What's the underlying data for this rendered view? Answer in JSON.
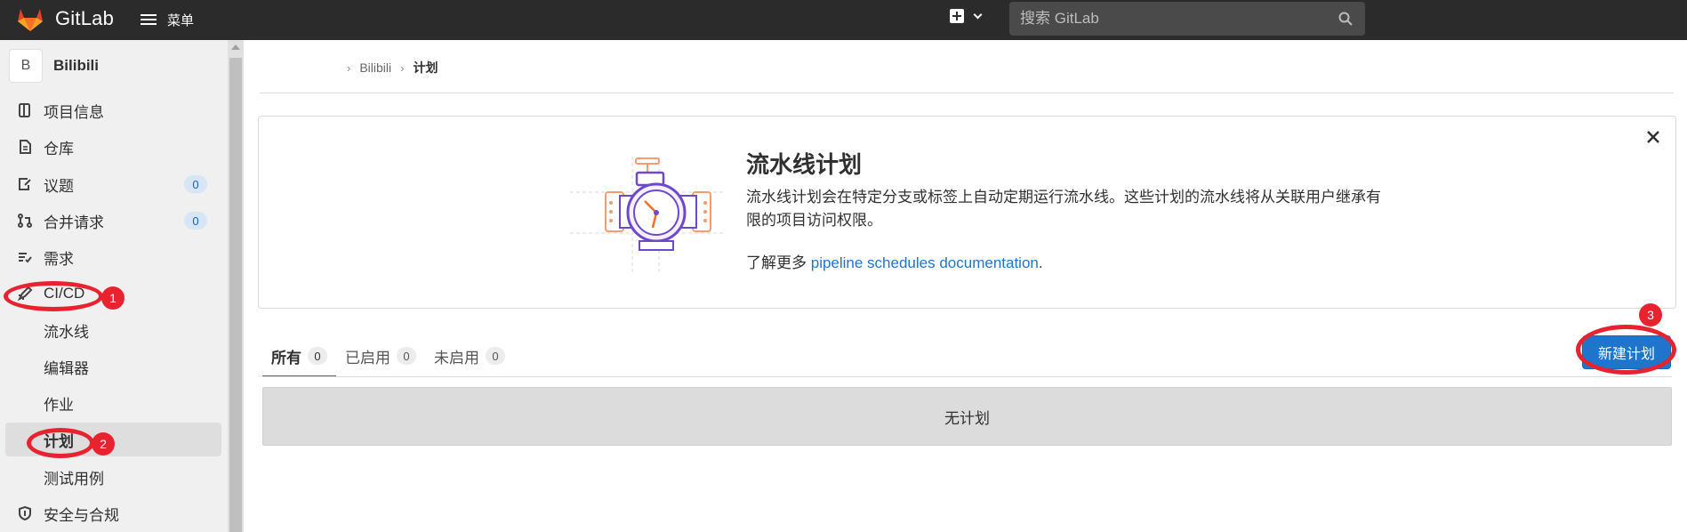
{
  "header": {
    "app_name": "GitLab",
    "menu_label": "菜单",
    "search_placeholder": "搜索 GitLab"
  },
  "sidebar": {
    "project_initial": "B",
    "project_name": "Bilibili",
    "items": [
      {
        "label": "项目信息",
        "icon": "info-icon"
      },
      {
        "label": "仓库",
        "icon": "document-icon"
      },
      {
        "label": "议题",
        "icon": "issues-icon",
        "badge": "0"
      },
      {
        "label": "合并请求",
        "icon": "merge-request-icon",
        "badge": "0"
      },
      {
        "label": "需求",
        "icon": "requirements-icon"
      },
      {
        "label": "CI/CD",
        "icon": "rocket-icon"
      }
    ],
    "cicd_sub": [
      "流水线",
      "编辑器",
      "作业",
      "计划",
      "测试用例"
    ],
    "security": {
      "label": "安全与合规",
      "icon": "shield-icon"
    }
  },
  "breadcrumb": {
    "project": "Bilibili",
    "current": "计划"
  },
  "banner": {
    "title": "流水线计划",
    "description": "流水线计划会在特定分支或标签上自动定期运行流水线。这些计划的流水线将从关联用户继承有限的项目访问权限。",
    "learn_more_prefix": "了解更多",
    "learn_more_link": "pipeline schedules documentation",
    "learn_more_suffix": "."
  },
  "tabs": [
    {
      "label": "所有",
      "count": "0"
    },
    {
      "label": "已启用",
      "count": "0"
    },
    {
      "label": "未启用",
      "count": "0"
    }
  ],
  "new_button": "新建计划",
  "empty_text": "无计划",
  "annotations": [
    "1",
    "2",
    "3"
  ],
  "colors": {
    "accent": "#1f75cb",
    "annotation": "#e8222f",
    "topbar": "#2b2b2b"
  }
}
